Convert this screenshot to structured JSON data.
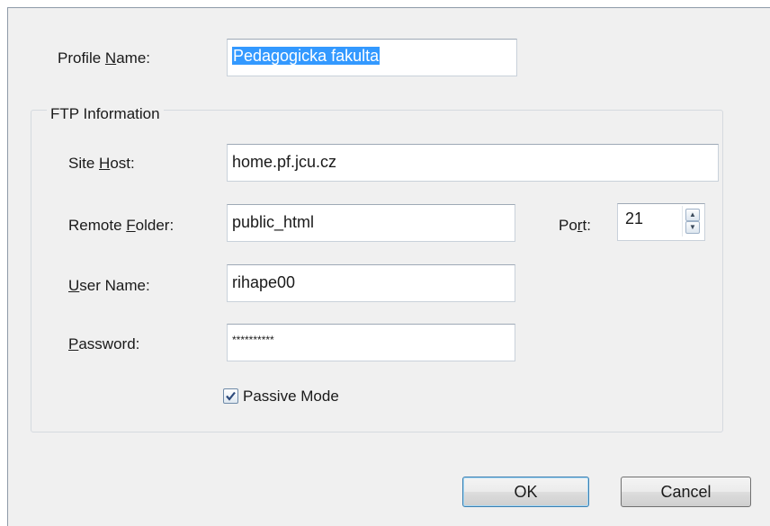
{
  "profile": {
    "label_before": "Profile ",
    "label_mnemonic": "N",
    "label_after": "ame:",
    "value": "Pedagogicka fakulta"
  },
  "ftp_group": {
    "title": "FTP Information"
  },
  "site_host": {
    "label_before": "Site ",
    "label_mnemonic": "H",
    "label_after": "ost:",
    "value": "home.pf.jcu.cz"
  },
  "remote_folder": {
    "label_before": "Remote ",
    "label_mnemonic": "F",
    "label_after": "older:",
    "value": "public_html"
  },
  "port": {
    "label_before": "Po",
    "label_mnemonic": "r",
    "label_after": "t:",
    "value": "21"
  },
  "user_name": {
    "label_mnemonic": "U",
    "label_after": "ser Name:",
    "value": "rihape00"
  },
  "password": {
    "label_mnemonic": "P",
    "label_after": "assword:",
    "value": "**********"
  },
  "passive_mode": {
    "label": "Passive Mode",
    "checked": true
  },
  "buttons": {
    "ok": "OK",
    "cancel": "Cancel"
  }
}
